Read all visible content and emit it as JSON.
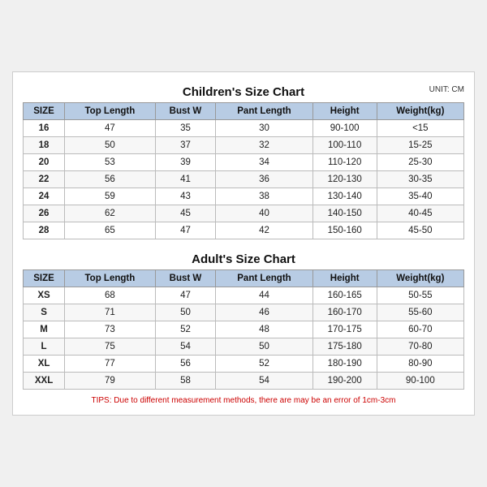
{
  "children_section": {
    "title": "Children's Size Chart",
    "unit": "UNIT: CM",
    "columns": [
      "SIZE",
      "Top Length",
      "Bust W",
      "Pant Length",
      "Height",
      "Weight(kg)"
    ],
    "rows": [
      [
        "16",
        "47",
        "35",
        "30",
        "90-100",
        "<15"
      ],
      [
        "18",
        "50",
        "37",
        "32",
        "100-110",
        "15-25"
      ],
      [
        "20",
        "53",
        "39",
        "34",
        "110-120",
        "25-30"
      ],
      [
        "22",
        "56",
        "41",
        "36",
        "120-130",
        "30-35"
      ],
      [
        "24",
        "59",
        "43",
        "38",
        "130-140",
        "35-40"
      ],
      [
        "26",
        "62",
        "45",
        "40",
        "140-150",
        "40-45"
      ],
      [
        "28",
        "65",
        "47",
        "42",
        "150-160",
        "45-50"
      ]
    ]
  },
  "adult_section": {
    "title": "Adult's Size Chart",
    "columns": [
      "SIZE",
      "Top Length",
      "Bust W",
      "Pant Length",
      "Height",
      "Weight(kg)"
    ],
    "rows": [
      [
        "XS",
        "68",
        "47",
        "44",
        "160-165",
        "50-55"
      ],
      [
        "S",
        "71",
        "50",
        "46",
        "160-170",
        "55-60"
      ],
      [
        "M",
        "73",
        "52",
        "48",
        "170-175",
        "60-70"
      ],
      [
        "L",
        "75",
        "54",
        "50",
        "175-180",
        "70-80"
      ],
      [
        "XL",
        "77",
        "56",
        "52",
        "180-190",
        "80-90"
      ],
      [
        "XXL",
        "79",
        "58",
        "54",
        "190-200",
        "90-100"
      ]
    ]
  },
  "tips": "TIPS: Due to different measurement methods, there are may be an error of 1cm-3cm"
}
